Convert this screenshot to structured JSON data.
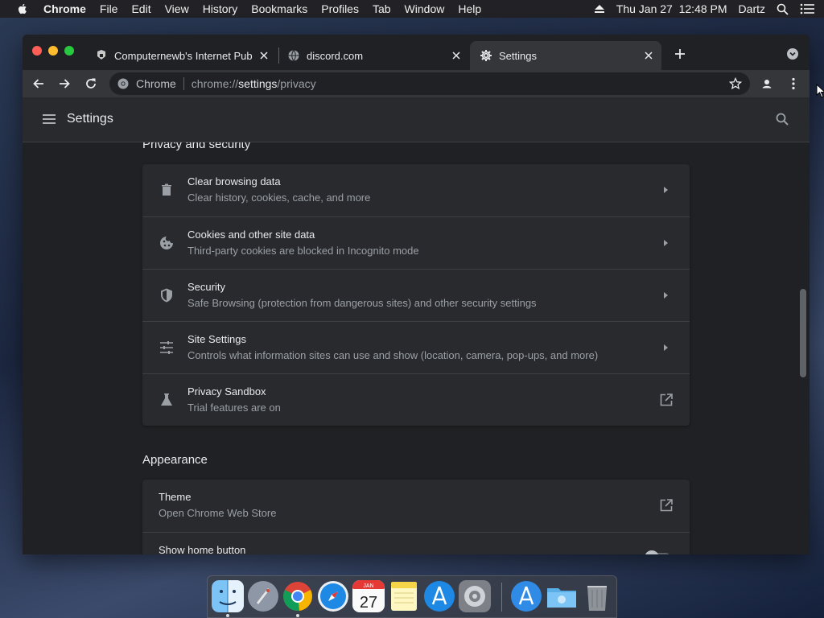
{
  "menubar": {
    "app_name": "Chrome",
    "items": [
      "File",
      "Edit",
      "View",
      "History",
      "Bookmarks",
      "Profiles",
      "Tab",
      "Window",
      "Help"
    ],
    "datetime": "Thu Jan 27  12:48 PM",
    "user": "Dartz"
  },
  "tabs": [
    {
      "title": "Computernewb's Internet Pub",
      "icon": "pub-favicon",
      "active": false
    },
    {
      "title": "discord.com",
      "icon": "globe-icon",
      "active": false
    },
    {
      "title": "Settings",
      "icon": "gear-icon",
      "active": true
    }
  ],
  "omnibox": {
    "chip": "Chrome",
    "url_scheme": "chrome://",
    "url_host": "settings",
    "url_path": "/privacy"
  },
  "settings": {
    "title": "Settings",
    "privacy_section": {
      "title": "Privacy and security",
      "rows": [
        {
          "title": "Clear browsing data",
          "subtitle": "Clear history, cookies, cache, and more",
          "icon": "trash-icon",
          "action": "arrow"
        },
        {
          "title": "Cookies and other site data",
          "subtitle": "Third-party cookies are blocked in Incognito mode",
          "icon": "cookie-icon",
          "action": "arrow"
        },
        {
          "title": "Security",
          "subtitle": "Safe Browsing (protection from dangerous sites) and other security settings",
          "icon": "shield-icon",
          "action": "arrow"
        },
        {
          "title": "Site Settings",
          "subtitle": "Controls what information sites can use and show (location, camera, pop-ups, and more)",
          "icon": "sliders-icon",
          "action": "arrow"
        },
        {
          "title": "Privacy Sandbox",
          "subtitle": "Trial features are on",
          "icon": "flask-icon",
          "action": "external"
        }
      ]
    },
    "appearance_section": {
      "title": "Appearance",
      "rows": [
        {
          "title": "Theme",
          "subtitle": "Open Chrome Web Store",
          "action": "external"
        },
        {
          "title": "Show home button",
          "subtitle": "",
          "action": "toggle"
        }
      ]
    }
  },
  "dock": {
    "apps": [
      "Finder",
      "Launchpad",
      "Google Chrome",
      "Safari",
      "Calendar",
      "Notes",
      "App Store",
      "System Preferences",
      "App Store",
      "Downloads",
      "Trash"
    ],
    "calendar": {
      "month": "JAN",
      "day": "27"
    }
  },
  "colors": {
    "window_bg": "#202124",
    "card_bg": "#292a2d",
    "toolbar_bg": "#35363a",
    "text_primary": "#e8eaed",
    "text_secondary": "#9aa0a6"
  }
}
